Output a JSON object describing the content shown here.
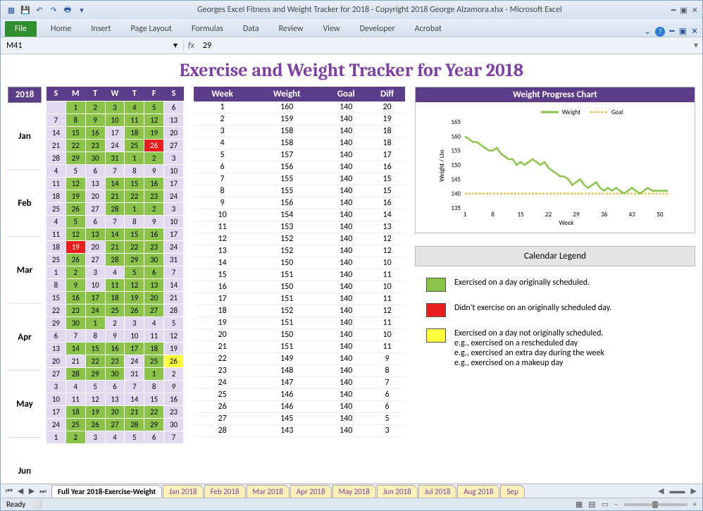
{
  "window": {
    "title": "Georges Excel Fitness and Weight Tracker for 2018 - Copyright 2018 George Alzamora.xlsx  -  Microsoft Excel"
  },
  "ribbon": {
    "file": "File",
    "tabs": [
      "Home",
      "Insert",
      "Page Layout",
      "Formulas",
      "Data",
      "Review",
      "View",
      "Developer",
      "Acrobat"
    ]
  },
  "formula_bar": {
    "name": "M41",
    "value": "29"
  },
  "sheet_title": "Exercise and Weight Tracker for Year 2018",
  "calendar": {
    "year": "2018",
    "days": [
      "S",
      "M",
      "T",
      "W",
      "T",
      "F",
      "S"
    ],
    "months": [
      "Jan",
      "Feb",
      "Mar",
      "Apr",
      "May",
      "Jun"
    ],
    "rows": [
      [
        "",
        "1g",
        "2g",
        "3g",
        "4g",
        "5g",
        "6"
      ],
      [
        "7",
        "8g",
        "9g",
        "10g",
        "11g",
        "12g",
        "13"
      ],
      [
        "14",
        "15g",
        "16g",
        "17p",
        "18g",
        "19g",
        "20"
      ],
      [
        "21",
        "22g",
        "23g",
        "24p",
        "25g",
        "26r",
        "27"
      ],
      [
        "28",
        "29g",
        "30g",
        "31g",
        "1g",
        "2g",
        "3"
      ],
      [
        "4",
        "5p",
        "6p",
        "7p",
        "8p",
        "9p",
        "10"
      ],
      [
        "11",
        "12g",
        "13p",
        "14g",
        "15g",
        "16g",
        "17"
      ],
      [
        "18",
        "19g",
        "20p",
        "21g",
        "22g",
        "23g",
        "24"
      ],
      [
        "25",
        "26g",
        "27p",
        "28g",
        "1g",
        "2g",
        "3"
      ],
      [
        "4",
        "5g",
        "6p",
        "7p",
        "8p",
        "9p",
        "10"
      ],
      [
        "11",
        "12g",
        "13g",
        "14g",
        "15g",
        "16g",
        "17"
      ],
      [
        "18",
        "19r",
        "20p",
        "21g",
        "22g",
        "23g",
        "24"
      ],
      [
        "25",
        "26g",
        "27p",
        "28g",
        "29g",
        "30g",
        "31"
      ],
      [
        "1",
        "2g",
        "3p",
        "4p",
        "5g",
        "6g",
        "7"
      ],
      [
        "8",
        "9g",
        "10p",
        "11g",
        "12g",
        "13g",
        "14"
      ],
      [
        "15",
        "16g",
        "17g",
        "18g",
        "19g",
        "20g",
        "21"
      ],
      [
        "22",
        "23g",
        "24g",
        "25g",
        "26g",
        "27g",
        "28"
      ],
      [
        "29",
        "30g",
        "1g",
        "2p",
        "3p",
        "4p",
        "5"
      ],
      [
        "6",
        "7p",
        "8p",
        "9p",
        "10p",
        "11p",
        "12"
      ],
      [
        "13",
        "14g",
        "15g",
        "16g",
        "17g",
        "18g",
        "19"
      ],
      [
        "20",
        "21p",
        "22g",
        "23g",
        "24p",
        "25g",
        "26y"
      ],
      [
        "27",
        "28g",
        "29g",
        "30g",
        "31p",
        "1g",
        "2"
      ],
      [
        "3",
        "4p",
        "5p",
        "6p",
        "7p",
        "8p",
        "9"
      ],
      [
        "10",
        "11p",
        "12p",
        "13p",
        "14p",
        "15p",
        "16"
      ],
      [
        "17",
        "18g",
        "19g",
        "20g",
        "21g",
        "22g",
        "23"
      ],
      [
        "24",
        "25g",
        "26g",
        "27g",
        "28g",
        "29g",
        "30"
      ],
      [
        "1",
        "2g",
        "3p",
        "4p",
        "5p",
        "6p",
        "7"
      ]
    ]
  },
  "data_table": {
    "headers": [
      "Week",
      "Weight",
      "Goal",
      "Diff"
    ],
    "rows": [
      [
        1,
        160,
        140,
        20
      ],
      [
        2,
        159,
        140,
        19
      ],
      [
        3,
        158,
        140,
        18
      ],
      [
        4,
        158,
        140,
        18
      ],
      [
        5,
        157,
        140,
        17
      ],
      [
        6,
        156,
        140,
        16
      ],
      [
        7,
        155,
        140,
        15
      ],
      [
        8,
        155,
        140,
        15
      ],
      [
        9,
        156,
        140,
        16
      ],
      [
        10,
        154,
        140,
        14
      ],
      [
        11,
        153,
        140,
        13
      ],
      [
        12,
        152,
        140,
        12
      ],
      [
        13,
        152,
        140,
        12
      ],
      [
        14,
        150,
        140,
        10
      ],
      [
        15,
        151,
        140,
        11
      ],
      [
        16,
        150,
        140,
        10
      ],
      [
        17,
        151,
        140,
        11
      ],
      [
        18,
        152,
        140,
        12
      ],
      [
        19,
        151,
        140,
        11
      ],
      [
        20,
        150,
        140,
        10
      ],
      [
        21,
        151,
        140,
        11
      ],
      [
        22,
        149,
        140,
        9
      ],
      [
        23,
        148,
        140,
        8
      ],
      [
        24,
        147,
        140,
        7
      ],
      [
        25,
        146,
        140,
        6
      ],
      [
        26,
        146,
        140,
        6
      ],
      [
        27,
        145,
        140,
        5
      ],
      [
        28,
        143,
        140,
        3
      ]
    ]
  },
  "chart_data": {
    "type": "line",
    "title": "Weight Progress Chart",
    "xlabel": "Week",
    "ylabel": "Weight / Lbs",
    "x": [
      1,
      8,
      15,
      22,
      29,
      36,
      43,
      50
    ],
    "ylim": [
      135,
      165
    ],
    "yticks": [
      135,
      140,
      145,
      150,
      155,
      160,
      165
    ],
    "series": [
      {
        "name": "Weight",
        "color": "#8bc34a",
        "values": [
          160,
          159,
          158,
          158,
          157,
          156,
          155,
          155,
          156,
          154,
          153,
          152,
          152,
          150,
          151,
          150,
          151,
          152,
          151,
          150,
          151,
          149,
          148,
          147,
          146,
          146,
          145,
          143,
          144,
          145,
          143,
          142,
          143,
          144,
          142,
          141,
          142,
          141,
          142,
          141,
          140,
          141,
          142,
          141,
          140,
          141,
          142,
          141,
          141,
          141,
          141,
          141
        ]
      },
      {
        "name": "Goal",
        "color": "#f0b429",
        "dashed": true,
        "values_const": 140
      }
    ]
  },
  "legend": {
    "title": "Calendar Legend",
    "items": [
      {
        "color": "g",
        "text": "Exercised on a day originally scheduled."
      },
      {
        "color": "r",
        "text": "Didn't exercise on an originally scheduled day."
      },
      {
        "color": "y",
        "text": "Exercised on a day not originally scheduled.\ne.g., exercised on a rescheduled day\ne.g., exercised an extra day during the week\ne.g., exercised on a makeup day"
      }
    ]
  },
  "sheet_tabs": {
    "active": "Full Year 2018-Exercise-Weight",
    "tabs": [
      "Full Year 2018-Exercise-Weight",
      "Jan 2018",
      "Feb 2018",
      "Mar 2018",
      "Apr 2018",
      "May 2018",
      "Jun 2018",
      "Jul 2018",
      "Aug 2018",
      "Sep"
    ]
  },
  "status": {
    "text": "Ready",
    "zoom": ""
  }
}
